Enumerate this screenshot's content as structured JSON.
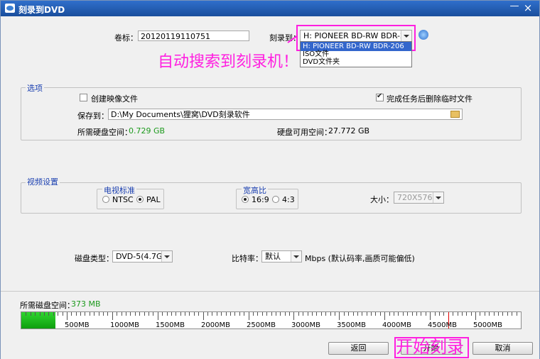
{
  "window": {
    "title": "刻录到DVD",
    "min_label": "—",
    "close_label": "×"
  },
  "top": {
    "volume_label": "卷标：",
    "volume_value": "20120119110751",
    "burn_to_label": "刻录到：",
    "burn_to_value": "H: PIONEER  BD-RW    BDR-2...",
    "dropdown_options": [
      "H: PIONEER  BD-RW    BDR-206",
      "ISO文件",
      "DVD文件夹"
    ]
  },
  "options": {
    "title": "选项",
    "create_image_label": "创建映像文件",
    "create_image_checked": false,
    "delete_temp_label": "完成任务后删除临时文件",
    "delete_temp_checked": true,
    "save_to_label": "保存到：",
    "save_to_value": "D:\\My Documents\\狸窝\\DVD刻录软件",
    "required_disk_label": "所需硬盘空间：",
    "required_disk_value": "0.729 GB",
    "available_disk_label": "硬盘可用空间：",
    "available_disk_value": "27.772 GB"
  },
  "video": {
    "title": "视频设置",
    "tv_standard_title": "电视标准",
    "tv_ntsc": "NTSC",
    "tv_pal": "PAL",
    "tv_selected": "PAL",
    "aspect_title": "宽高比",
    "aspect_169": "16:9",
    "aspect_43": "4:3",
    "aspect_selected": "16:9",
    "size_label": "大小：",
    "size_value": "720X576"
  },
  "disc": {
    "type_label": "磁盘类型：",
    "type_value": "DVD-5(4.7GB)",
    "bitrate_label": "比特率：",
    "bitrate_value": "默认",
    "bitrate_suffix": "Mbps (默认码率,画质可能偏低)"
  },
  "space": {
    "label": "所需磁盘空间：",
    "value": "373 MB",
    "used_mb": 373,
    "capacity_mb": 4700,
    "max_mb": 5500,
    "ticks": [
      "500MB",
      "1000MB",
      "1500MB",
      "2000MB",
      "2500MB",
      "3000MB",
      "3500MB",
      "4000MB",
      "4500MB",
      "5000MB"
    ]
  },
  "buttons": {
    "back": "返回",
    "start": "开始",
    "cancel": "取消"
  },
  "annotations": {
    "auto_search": "自动搜索到刻录机！",
    "start_burn": "开始刻录",
    "color": "#ff1fe0"
  }
}
